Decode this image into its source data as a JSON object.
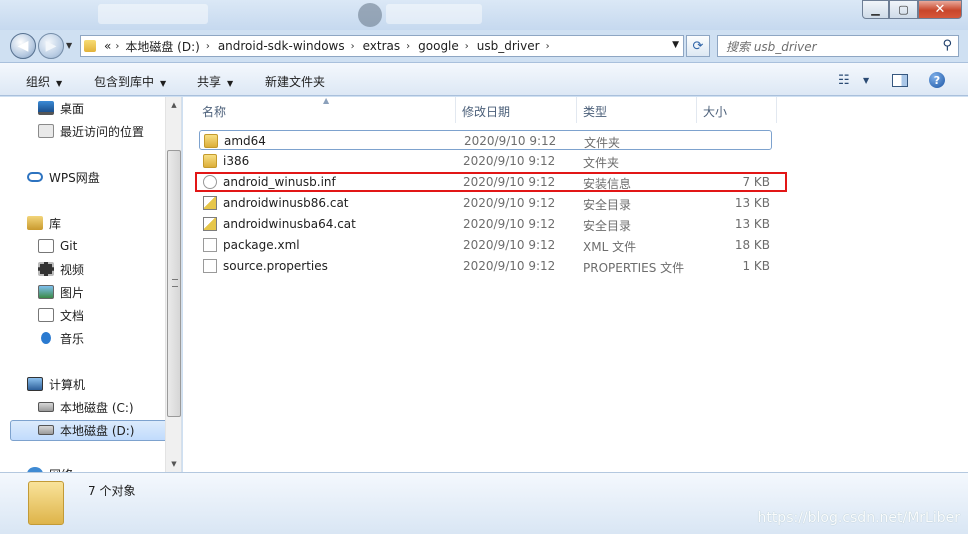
{
  "window": {
    "min_glyph": "▁",
    "max_glyph": "▢",
    "close_glyph": "✕"
  },
  "address": {
    "breadcrumb_prefix": "«",
    "crumbs": [
      "本地磁盘 (D:)",
      "android-sdk-windows",
      "extras",
      "google",
      "usb_driver"
    ],
    "separator": "›"
  },
  "search": {
    "placeholder": "搜索 usb_driver"
  },
  "toolbar": {
    "organize": "组织",
    "include_library": "包含到库中",
    "share": "共享",
    "new_folder": "新建文件夹"
  },
  "sidebar": {
    "items": [
      {
        "label": "桌面",
        "icon": "desktop-icon"
      },
      {
        "label": "最近访问的位置",
        "icon": "recent-places-icon"
      },
      {
        "label": "WPS网盘",
        "icon": "cloud-icon"
      },
      {
        "label": "库",
        "icon": "library-icon"
      },
      {
        "label": "Git",
        "icon": "git-icon"
      },
      {
        "label": "视频",
        "icon": "video-icon"
      },
      {
        "label": "图片",
        "icon": "picture-icon"
      },
      {
        "label": "文档",
        "icon": "document-icon"
      },
      {
        "label": "音乐",
        "icon": "music-icon"
      },
      {
        "label": "计算机",
        "icon": "computer-icon"
      },
      {
        "label": "本地磁盘 (C:)",
        "icon": "drive-c-icon"
      },
      {
        "label": "本地磁盘 (D:)",
        "icon": "drive-d-icon"
      },
      {
        "label": "网络",
        "icon": "network-icon"
      }
    ]
  },
  "columns": {
    "name": "名称",
    "modified": "修改日期",
    "type": "类型",
    "size": "大小"
  },
  "files": [
    {
      "name": "amd64",
      "date": "2020/9/10 9:12",
      "type": "文件夹",
      "size": "",
      "icon": "folder-icon"
    },
    {
      "name": "i386",
      "date": "2020/9/10 9:12",
      "type": "文件夹",
      "size": "",
      "icon": "folder-icon"
    },
    {
      "name": "android_winusb.inf",
      "date": "2020/9/10 9:12",
      "type": "安装信息",
      "size": "7 KB",
      "icon": "setup-info-icon"
    },
    {
      "name": "androidwinusb86.cat",
      "date": "2020/9/10 9:12",
      "type": "安全目录",
      "size": "13 KB",
      "icon": "catalog-icon"
    },
    {
      "name": "androidwinusba64.cat",
      "date": "2020/9/10 9:12",
      "type": "安全目录",
      "size": "13 KB",
      "icon": "catalog-icon"
    },
    {
      "name": "package.xml",
      "date": "2020/9/10 9:12",
      "type": "XML 文件",
      "size": "18 KB",
      "icon": "xml-file-icon"
    },
    {
      "name": "source.properties",
      "date": "2020/9/10 9:12",
      "type": "PROPERTIES 文件",
      "size": "1 KB",
      "icon": "file-icon"
    }
  ],
  "status": {
    "count": "7 个对象"
  },
  "watermark": "https://blog.csdn.net/MrLiber"
}
